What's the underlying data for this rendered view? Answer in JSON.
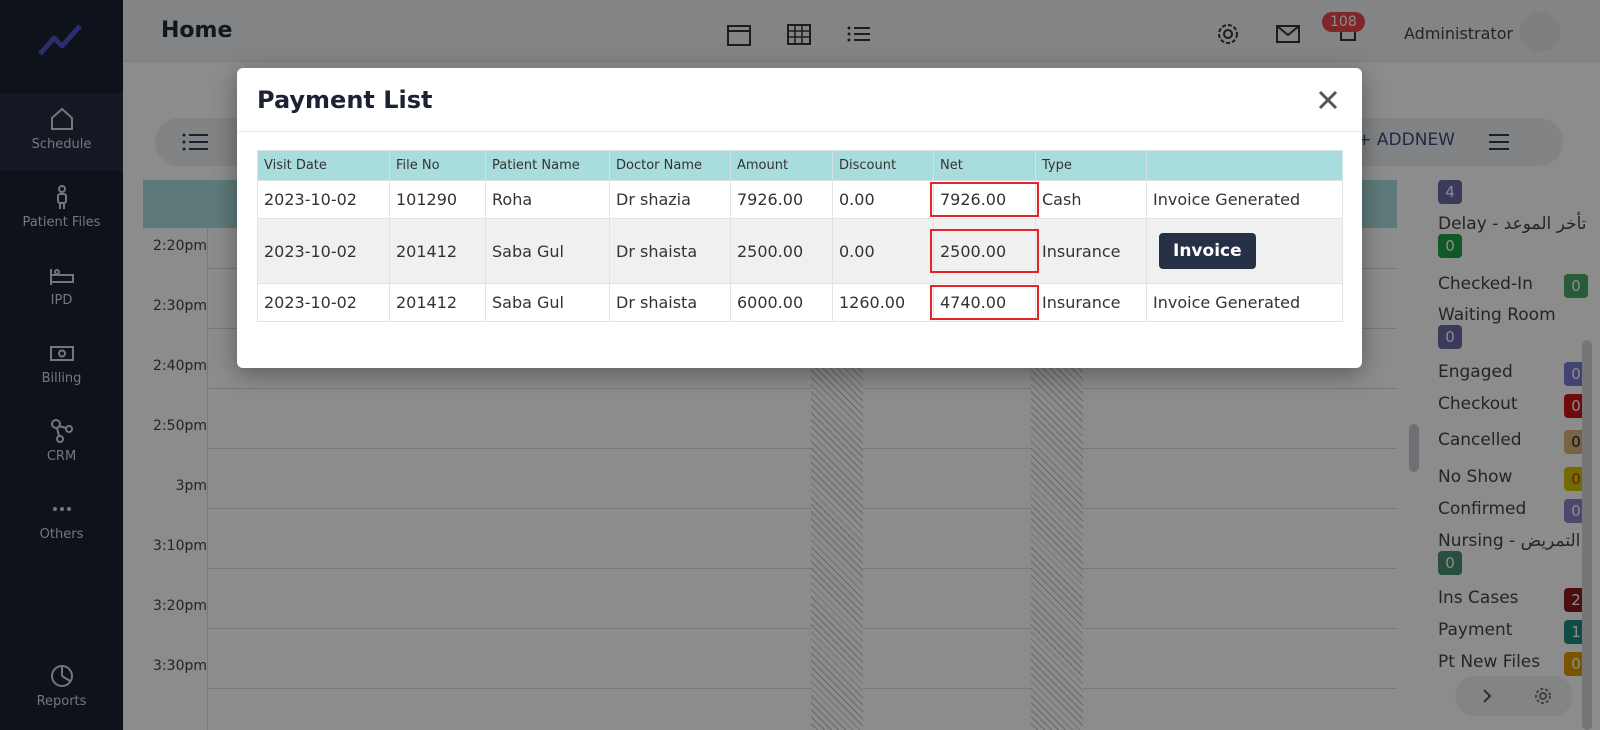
{
  "header": {
    "title": "Home",
    "notification_count": "108",
    "user_name": "Administrator"
  },
  "sidebar": {
    "items": [
      {
        "label": "Schedule",
        "icon": "home-icon"
      },
      {
        "label": "Patient Files",
        "icon": "person-icon"
      },
      {
        "label": "IPD",
        "icon": "bed-icon"
      },
      {
        "label": "Billing",
        "icon": "money-icon"
      },
      {
        "label": "CRM",
        "icon": "nodes-icon"
      },
      {
        "label": "Others",
        "icon": "more-icon"
      },
      {
        "label": "Reports",
        "icon": "pie-chart-icon"
      }
    ]
  },
  "subbar": {
    "add_new_label": "+ ADDNEW"
  },
  "schedule": {
    "times": [
      "2:20pm",
      "2:30pm",
      "2:40pm",
      "2:50pm",
      "3pm",
      "3:10pm",
      "3:20pm",
      "3:30pm"
    ]
  },
  "status_panel": {
    "items": [
      {
        "label": "",
        "count": "4",
        "color": "#6c6aa8"
      },
      {
        "label": "Delay - تأخر الموعد",
        "count": "0",
        "color": "#1fa04a"
      },
      {
        "label": "Checked-In",
        "count": "0",
        "color": "#4aa868"
      },
      {
        "label": "Waiting Room",
        "count": "0",
        "color": "#6c6aa8"
      },
      {
        "label": "Engaged",
        "count": "0",
        "color": "#7b7bd0"
      },
      {
        "label": "Checkout",
        "count": "0",
        "color": "#cc1414"
      },
      {
        "label": "Cancelled",
        "count": "0",
        "color": "#d9b77d"
      },
      {
        "label": "No Show",
        "count": "0",
        "color": "#d3c300"
      },
      {
        "label": "Confirmed",
        "count": "0",
        "color": "#8a84c8"
      },
      {
        "label": "Nursing - التمريض",
        "count": "0",
        "color": "#4a8f6f"
      },
      {
        "label": "Ins Cases",
        "count": "2",
        "color": "#8b1c1c"
      },
      {
        "label": "Payment",
        "count": "1",
        "color": "#1a8a80"
      },
      {
        "label": "Pt New Files",
        "count": "0",
        "color": "#e09a00"
      }
    ]
  },
  "modal": {
    "title": "Payment List",
    "columns": [
      "Visit Date",
      "File No",
      "Patient Name",
      "Doctor Name",
      "Amount",
      "Discount",
      "Net",
      "Type",
      ""
    ],
    "rows": [
      {
        "visit_date": "2023-10-02",
        "file_no": "101290",
        "patient": "Roha",
        "doctor": "Dr shazia",
        "amount": "7926.00",
        "discount": "0.00",
        "net": "7926.00",
        "type": "Cash",
        "action": "Invoice Generated"
      },
      {
        "visit_date": "2023-10-02",
        "file_no": "201412",
        "patient": "Saba Gul",
        "doctor": "Dr shaista",
        "amount": "2500.00",
        "discount": "0.00",
        "net": "2500.00",
        "type": "Insurance",
        "action": "Invoice"
      },
      {
        "visit_date": "2023-10-02",
        "file_no": "201412",
        "patient": "Saba Gul",
        "doctor": "Dr shaista",
        "amount": "6000.00",
        "discount": "1260.00",
        "net": "4740.00",
        "type": "Insurance",
        "action": "Invoice Generated"
      }
    ]
  }
}
